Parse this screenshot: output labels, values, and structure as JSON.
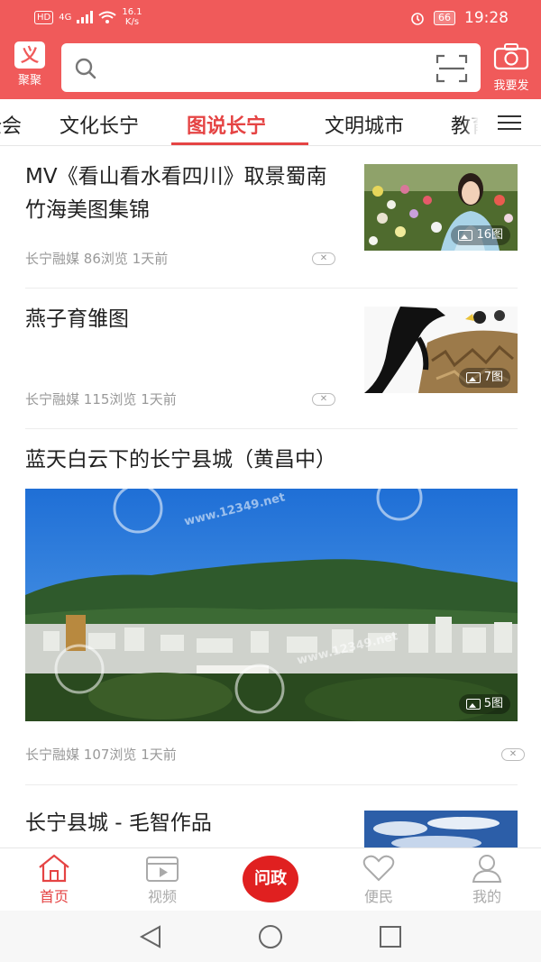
{
  "status_bar": {
    "hd": "HD",
    "signal": "4G",
    "net_speed": "16.1",
    "net_unit": "K/s",
    "battery": "66",
    "time": "19:28"
  },
  "header": {
    "logo_label": "聚聚",
    "search_placeholder": "",
    "camera_label": "我要发"
  },
  "tabs": [
    {
      "label": "全会",
      "active": false
    },
    {
      "label": "文化长宁",
      "active": false
    },
    {
      "label": "图说长宁",
      "active": true
    },
    {
      "label": "文明城市",
      "active": false
    },
    {
      "label": "教育",
      "active": false
    }
  ],
  "feed": [
    {
      "title": "MV《看山看水看四川》取景蜀南竹海美图集锦",
      "source": "长宁融媒",
      "views": "86浏览",
      "time": "1天前",
      "image_count": "16图"
    },
    {
      "title": "燕子育雏图",
      "source": "长宁融媒",
      "views": "115浏览",
      "time": "1天前",
      "image_count": "7图"
    },
    {
      "title": "蓝天白云下的长宁县城（黄昌中）",
      "source": "长宁融媒",
      "views": "107浏览",
      "time": "1天前",
      "image_count": "5图",
      "watermark": "www.12349.net"
    },
    {
      "title": "长宁县城 - 毛智作品"
    }
  ],
  "bottom_nav": [
    {
      "label": "首页",
      "icon": "home-icon",
      "active": true
    },
    {
      "label": "视频",
      "icon": "video-icon",
      "active": false
    },
    {
      "label": "问政",
      "icon": "wenzheng-logo",
      "active": false
    },
    {
      "label": "便民",
      "icon": "heart-icon",
      "active": false
    },
    {
      "label": "我的",
      "icon": "user-icon",
      "active": false
    }
  ],
  "colors": {
    "brand": "#f05a5a",
    "accent": "#e54444"
  }
}
